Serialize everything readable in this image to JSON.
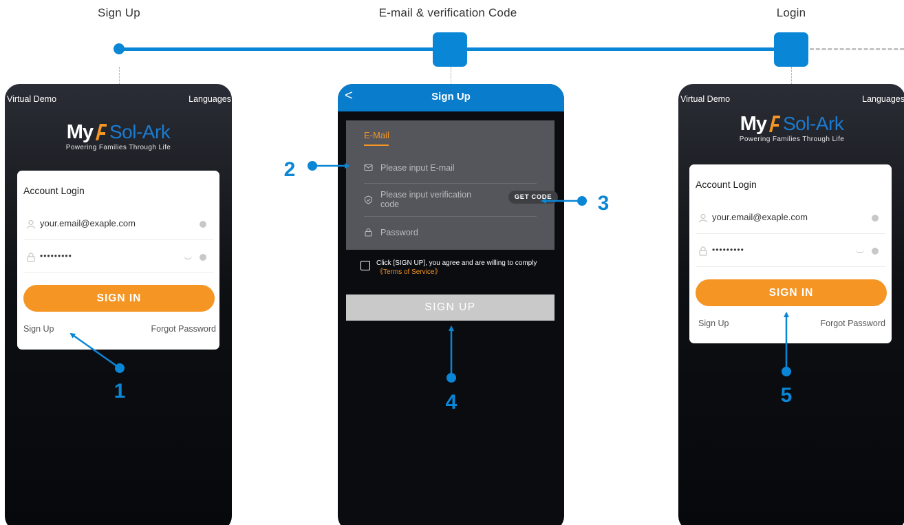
{
  "steps": {
    "sign_up": "Sign Up",
    "email_code": "E-mail & verification Code",
    "login": "Login"
  },
  "login_screen": {
    "virtual_demo": "Virtual Demo",
    "languages": "Languages",
    "logo_my": "My",
    "logo_brand": "Sol-Ark",
    "logo_tagline": "Powering Families Through Life",
    "card_title": "Account Login",
    "email_value": "your.email@exaple.com",
    "password_value": "•••••••••",
    "signin_label": "SIGN IN",
    "signup_link": "Sign Up",
    "forgot_link": "Forgot Password"
  },
  "signup_screen": {
    "back": "<",
    "title": "Sign Up",
    "tab_email": "E-Mail",
    "email_placeholder": "Please input E-mail",
    "code_placeholder_line1": "Please input verification",
    "code_placeholder_line2": "code",
    "get_code": "GET CODE",
    "password_placeholder": "Password",
    "agree_text": "Click [SIGN UP], you agree and are willing to comply",
    "terms_link": "《Terms of Service》",
    "signup_label": "SIGN UP"
  },
  "annotations": [
    "1",
    "2",
    "3",
    "4",
    "5"
  ],
  "colors": {
    "accent_blue": "#0a86d6",
    "brand_orange": "#f59524",
    "header_blue": "#0a7ccc",
    "disabled_gray": "#c9c9c9"
  }
}
